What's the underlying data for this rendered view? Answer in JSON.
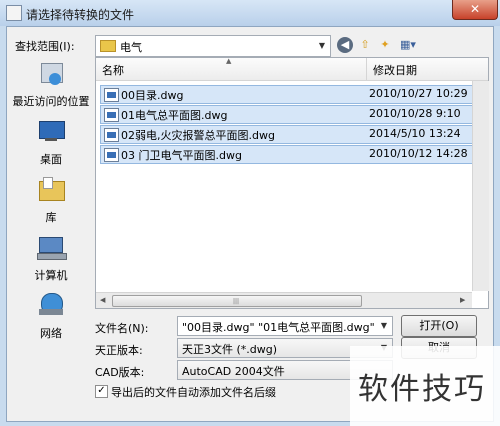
{
  "window": {
    "title": "请选择待转换的文件",
    "close_glyph": "✕"
  },
  "lookin": {
    "label": "查找范围(I):",
    "value": "电气"
  },
  "places": [
    {
      "label": "最近访问的位置"
    },
    {
      "label": "桌面"
    },
    {
      "label": "库"
    },
    {
      "label": "计算机"
    },
    {
      "label": "网络"
    }
  ],
  "columns": {
    "name": "名称",
    "date": "修改日期"
  },
  "files": [
    {
      "name": "00目录.dwg",
      "date": "2010/10/27 10:29"
    },
    {
      "name": "01电气总平面图.dwg",
      "date": "2010/10/28 9:10"
    },
    {
      "name": "02弱电,火灾报警总平面图.dwg",
      "date": "2014/5/10 13:24"
    },
    {
      "name": "03 门卫电气平面图.dwg",
      "date": "2010/10/12 14:28"
    }
  ],
  "form": {
    "filename_label": "文件名(N):",
    "filename_value": "\"00目录.dwg\" \"01电气总平面图.dwg\" \"02",
    "tzversion_label": "天正版本:",
    "tzversion_value": "天正3文件 (*.dwg)",
    "cadversion_label": "CAD版本:",
    "cadversion_value": "AutoCAD 2004文件",
    "checkbox_label": "导出后的文件自动添加文件名后缀",
    "checkbox_checked": true
  },
  "buttons": {
    "open": "打开(O)",
    "cancel": "取消"
  },
  "watermark": "软件技巧"
}
